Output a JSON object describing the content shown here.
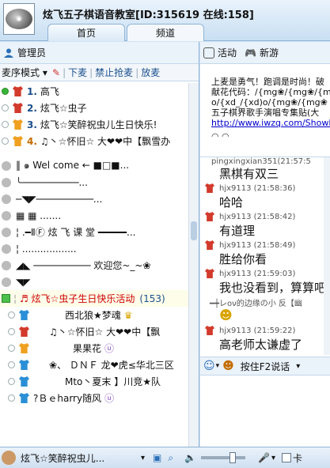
{
  "header": {
    "title": "炫飞五子棋语音教室[ID:315619 在线:158]",
    "tabs": [
      {
        "label": "首页"
      },
      {
        "label": "频道"
      }
    ]
  },
  "left": {
    "admin_label": "管理员",
    "mode_label": "麦序模式",
    "toolbar_links": [
      {
        "label": "下麦"
      },
      {
        "label": "禁止抢麦"
      },
      {
        "label": "放麦"
      }
    ],
    "queue": [
      {
        "index": "1.",
        "name": "高飞"
      },
      {
        "index": "2.",
        "name": "炫飞☆虫子"
      },
      {
        "index": "3.",
        "name": "炫飞☆笑醉祝虫儿生日快乐!"
      },
      {
        "index": "4.",
        "name": "♫丶☆怀旧☆ 大❤❤中【飘雪办"
      }
    ],
    "channel_rows": [
      "‖ ๑ Wel come ← ■□■...",
      "╰──────────...",
      "─◥◤──────────...",
      "▦ ▦ .......",
      "¦ .━ⅡⒻ 炫 飞 课 堂 ━━━━━...",
      "¦ ..................",
      "◢◣ ────────── 欢迎您~_~❀",
      "◥◤"
    ],
    "section": {
      "title": "♬ 炫飞☆虫子生日快乐活动",
      "count": "(153)"
    },
    "members": [
      "西北狼★梦魂",
      "♫丶☆怀旧☆ 大❤❤中【飘",
      "果果花",
      "❀、 ＤＮＦ 龙❤虎≤华北三区",
      "Mto丶夏末 】川竞★队",
      "?Ｂｅharry随风"
    ]
  },
  "right": {
    "tabs": [
      {
        "label": "活动"
      },
      {
        "label": "新游"
      }
    ],
    "notice": {
      "lines": [
        "上麦是勇气！跑调是时尚！破",
        "献花代码：/{mg❀/{mg❀/{mg",
        "o/{xd_/{xd)o/{mg❀/{mg❀",
        "五子棋界歌手演唱专集贴(大"
      ],
      "url": "http://www.iwzq.com/ShowP",
      "emoticons": "◠ ◠"
    },
    "chat": [
      {
        "user": "pingxingxian351",
        "time": "(21:57:5",
        "text": "黑棋有双三"
      },
      {
        "user": "hjx9113",
        "time": "(21:58:36)",
        "text": "哈哈"
      },
      {
        "user": "hjx9113",
        "time": "(21:58:42)",
        "text": "有道理"
      },
      {
        "user": "hjx9113",
        "time": "(21:58:49)",
        "text": "胜给你看"
      },
      {
        "user": "hjx9113",
        "time": "(21:59:03)",
        "text": "我也没看到，算算吧"
      },
      {
        "user": "hjx9113",
        "time": "(21:59:22)",
        "text": "高老师太谦虚了"
      }
    ],
    "marquee": "━┿レoν的边缘の小 反【幽",
    "talk_button": "按住F2说话"
  },
  "bottom": {
    "user_name": "炫飞☆笑醉祝虫儿...",
    "checkbox_label": "卡"
  },
  "colors": {
    "accent_blue": "#1a4f8c",
    "section_red": "#c00000",
    "link_blue": "#0000cc"
  }
}
